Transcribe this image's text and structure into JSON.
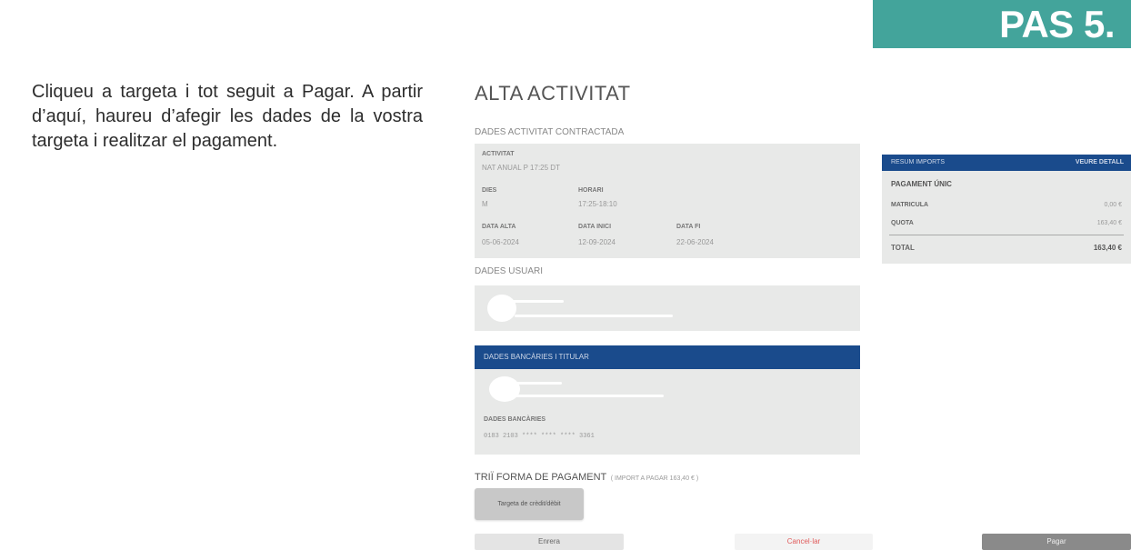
{
  "step": {
    "label": "PAS 5."
  },
  "instructions": "Cliqueu a targeta i tot seguit a Pagar. A partir d’aquí, haureu d’afegir les dades de la vostra targeta i realitzar el pagament.",
  "form": {
    "title": "ALTA ACTIVITAT",
    "activity_section": "DADES ACTIVITAT CONTRACTADA",
    "activity": {
      "activitat_label": "ACTIVITAT",
      "activitat_value": "NAT ANUAL P 17:25 DT",
      "dies_label": "DIES",
      "dies_value": "M",
      "horari_label": "HORARI",
      "horari_value": "17:25-18:10",
      "data_alta_label": "DATA ALTA",
      "data_alta_value": "05-06-2024",
      "data_inici_label": "DATA INICI",
      "data_inici_value": "12-09-2024",
      "data_fi_label": "DATA FI",
      "data_fi_value": "22-06-2024"
    },
    "user_section": "DADES USUARI",
    "bank_section": "DADES BANCÀRIES I TITULAR",
    "bank_label": "DADES BANCÀRIES",
    "bank_value": "0183 2103 **** **** **** 3361",
    "payment_title": "TRIÏ FORMA DE PAGAMENT",
    "payment_amount": "( IMPORT A PAGAR 163,40 € )",
    "card_button": "Targeta de crèdit/dèbit",
    "buttons": {
      "back": "Enrera",
      "cancel": "Cancel·lar",
      "pay": "Pagar"
    }
  },
  "summary": {
    "header": "RESUM IMPORTS",
    "details_link": "VEURE DETALL",
    "group_title": "PAGAMENT ÚNIC",
    "rows": [
      {
        "label": "MATRICULA",
        "value": "0,00 €"
      },
      {
        "label": "QUOTA",
        "value": "163,40 €"
      }
    ],
    "total_label": "TOTAL",
    "total_value": "163,40 €"
  },
  "colors": {
    "accent": "#43a49b",
    "primary_blue": "#1a4b8c",
    "cancel_red": "#e05a5a"
  }
}
